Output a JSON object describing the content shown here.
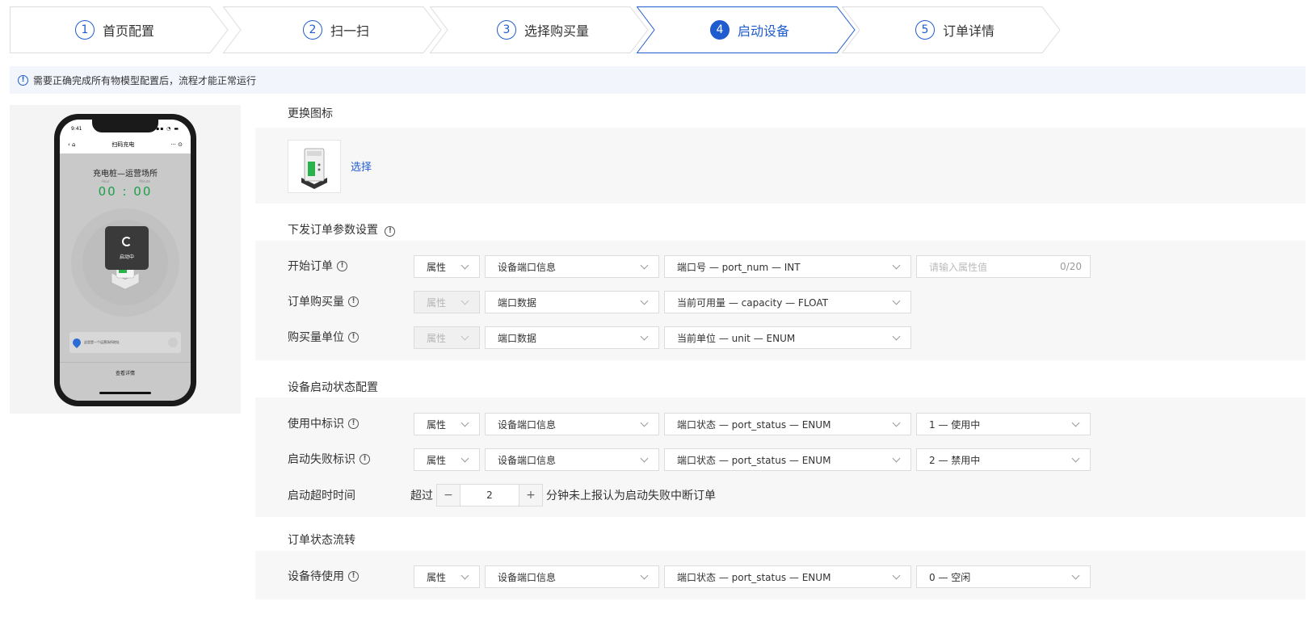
{
  "steps": [
    {
      "num": "1",
      "label": "首页配置"
    },
    {
      "num": "2",
      "label": "扫一扫"
    },
    {
      "num": "3",
      "label": "选择购买量"
    },
    {
      "num": "4",
      "label": "启动设备"
    },
    {
      "num": "5",
      "label": "订单详情"
    }
  ],
  "active_step": 4,
  "notice": "需要正确完成所有物模型配置后，流程才能正常运行",
  "phone": {
    "status_time": "9:41",
    "nav_title": "扫码充电",
    "title": "充电桩—运营场所",
    "sub_left": "Hour",
    "sub_right": "Minute",
    "time": "00 : 00",
    "overlay_text": "启动中",
    "card_text": "这里是一个运营场所地址",
    "bottom_link": "查看详情"
  },
  "icon_section": {
    "title": "更换图标",
    "choose": "选择"
  },
  "order_params": {
    "title": "下发订单参数设置",
    "rows": [
      {
        "label": "开始订单",
        "prop": "属性",
        "source": "设备端口信息",
        "field": "端口号 — port_num — INT",
        "input_placeholder": "请输入属性值",
        "input_count": "0/20"
      },
      {
        "label": "订单购买量",
        "prop": "属性",
        "source": "端口数据",
        "field": "当前可用量 — capacity — FLOAT"
      },
      {
        "label": "购买量单位",
        "prop": "属性",
        "source": "端口数据",
        "field": "当前单位 — unit — ENUM"
      }
    ]
  },
  "start_status": {
    "title": "设备启动状态配置",
    "rows": [
      {
        "label": "使用中标识",
        "prop": "属性",
        "source": "设备端口信息",
        "field": "端口状态 — port_status — ENUM",
        "value": "1 — 使用中"
      },
      {
        "label": "启动失败标识",
        "prop": "属性",
        "source": "设备端口信息",
        "field": "端口状态 — port_status — ENUM",
        "value": "2 — 禁用中"
      }
    ],
    "timeout": {
      "label": "启动超时时间",
      "prefix": "超过",
      "value": "2",
      "minus": "−",
      "plus": "+",
      "suffix": "分钟未上报认为启动失败中断订单"
    }
  },
  "order_flow": {
    "title": "订单状态流转",
    "rows": [
      {
        "label": "设备待使用",
        "prop": "属性",
        "source": "设备端口信息",
        "field": "端口状态 — port_status — ENUM",
        "value": "0 — 空闲"
      }
    ]
  },
  "colors": {
    "accent": "#1f5ccf",
    "notice_bg": "#f2f6fc",
    "timer_green": "#1d9e4a"
  }
}
